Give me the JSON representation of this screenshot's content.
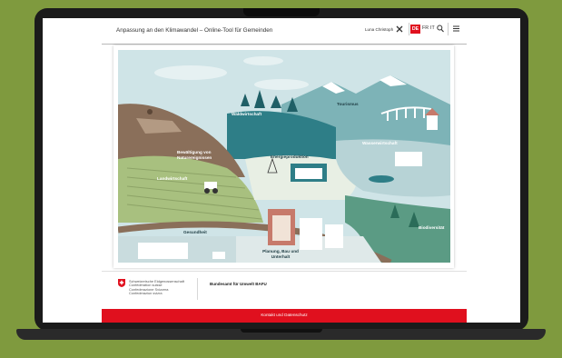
{
  "header": {
    "title": "Anpassung an den Klimawandel – Online-Tool für Gemeinden",
    "user_name": "Luna Christoph",
    "languages": [
      "DE",
      "FR",
      "IT"
    ],
    "active_language": "DE",
    "icons": [
      "close-icon",
      "search-icon",
      "menu-icon"
    ]
  },
  "illustration": {
    "sectors": [
      "Waldwirtschaft",
      "Tourismus",
      "Bewältigung von Naturereignissen",
      "Wasserwirtschaft",
      "Energieproduktion",
      "Landwirtschaft",
      "Biodiversität",
      "Gesundheit",
      "Planung, Bau und Unterhalt"
    ]
  },
  "footer": {
    "confederation_lines": [
      "Schweizerische Eidgenossenschaft",
      "Confédération suisse",
      "Confederazione Svizzera",
      "Confederaziun svizra"
    ],
    "office_name": "Bundesamt für Umwelt BAFU",
    "link_label": "Kontakt und Datenschutz"
  },
  "colors": {
    "accent_red": "#e0101e",
    "teal": "#2e7e87",
    "background_green": "#7f9a3e"
  }
}
